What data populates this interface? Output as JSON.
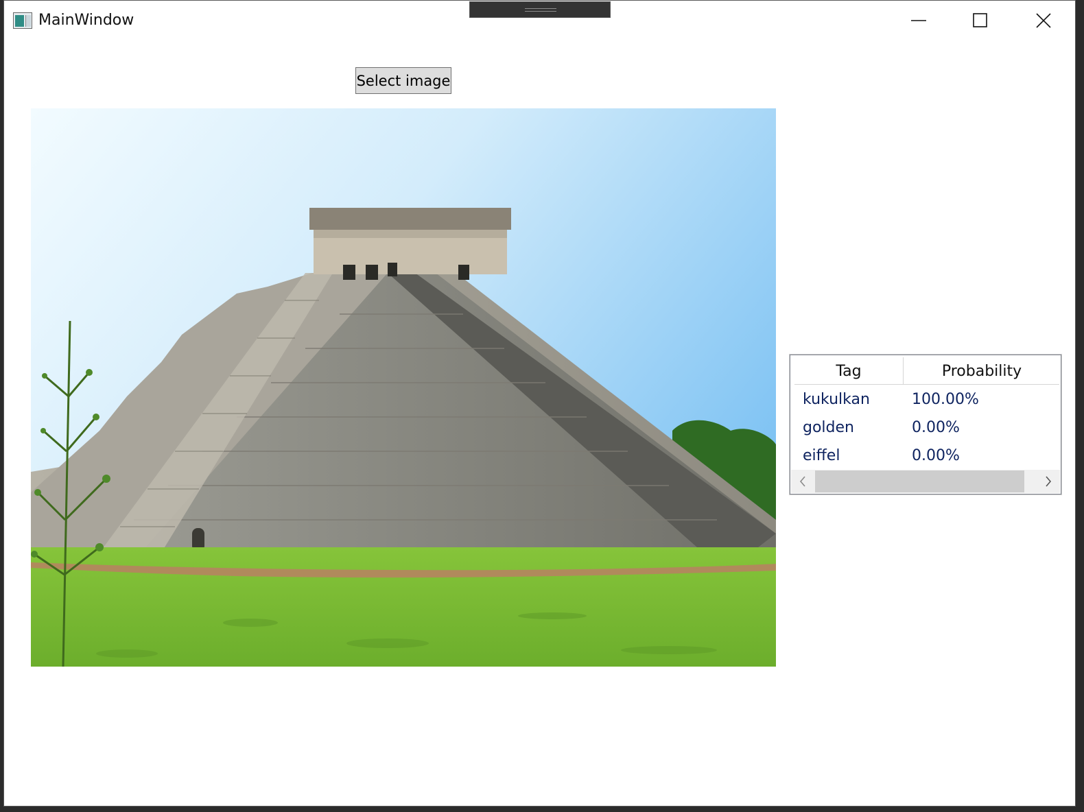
{
  "window": {
    "title": "MainWindow",
    "icons": {
      "app": "app-window-icon",
      "minimize": "minimize-icon",
      "maximize": "maximize-icon",
      "close": "close-icon"
    }
  },
  "toolbar": {
    "select_image_label": "Select image"
  },
  "image": {
    "subject": "step pyramid photo"
  },
  "results": {
    "columns": {
      "tag": "Tag",
      "probability": "Probability"
    },
    "rows": [
      {
        "tag": "kukulkan",
        "probability": "100.00%"
      },
      {
        "tag": "golden",
        "probability": "0.00%"
      },
      {
        "tag": "eiffel",
        "probability": "0.00%"
      }
    ],
    "scrollbar": {
      "left_icon": "chevron-left-icon",
      "right_icon": "chevron-right-icon"
    }
  },
  "colors": {
    "cell_text": "#0f2460",
    "button_bg": "#dddddd",
    "scroll_thumb": "#cdcdcd"
  }
}
